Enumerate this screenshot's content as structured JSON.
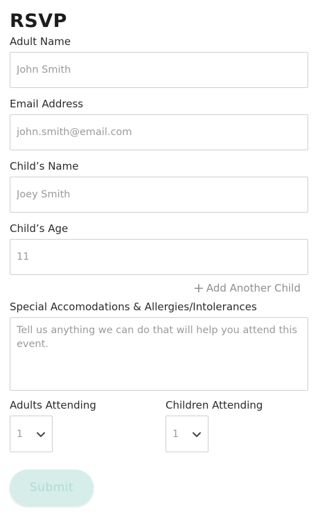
{
  "form": {
    "title": "RSVP",
    "adult_name": {
      "label": "Adult Name",
      "placeholder": "John Smith"
    },
    "email": {
      "label": "Email Address",
      "placeholder": "john.smith@email.com"
    },
    "child_name": {
      "label": "Child’s Name",
      "placeholder": "Joey Smith"
    },
    "child_age": {
      "label": "Child’s Age",
      "placeholder": "11"
    },
    "add_child": {
      "icon": "+",
      "label": "Add Another Child"
    },
    "special": {
      "label": "Special Accomodations & Allergies/Intolerances",
      "placeholder": "Tell us anything we can do that will help you attend this event."
    },
    "adults_attending": {
      "label": "Adults Attending",
      "value": "1"
    },
    "children_attending": {
      "label": "Children Attending",
      "value": "1"
    },
    "submit_label": "Submit"
  },
  "colors": {
    "submit_bg": "#d6ede9",
    "submit_text": "#b4d9d3",
    "border": "#cfcfcf",
    "placeholder": "#9a9a9a"
  }
}
